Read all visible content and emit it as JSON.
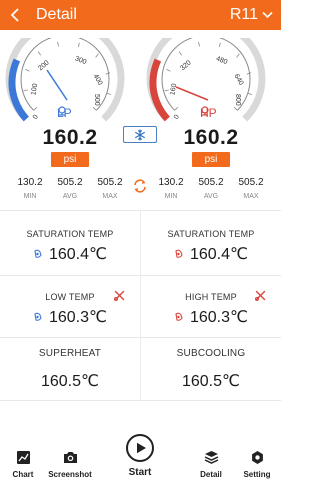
{
  "header": {
    "title": "Detail",
    "refrigerant": "R11"
  },
  "lp": {
    "label": "LP",
    "value": "160.2",
    "unit": "psi",
    "scale": [
      "0",
      "100",
      "200",
      "300",
      "400",
      "500"
    ],
    "min": "130.2",
    "avg": "505.2",
    "max": "505.2",
    "color": "#3c78d8"
  },
  "hp": {
    "label": "HP",
    "value": "160.2",
    "unit": "psi",
    "scale": [
      "0",
      "160",
      "320",
      "480",
      "640",
      "800"
    ],
    "min": "130.2",
    "avg": "505.2",
    "max": "505.2",
    "color": "#d8453c"
  },
  "stat_labels": {
    "min": "MIN",
    "avg": "AVG",
    "max": "MAX"
  },
  "readings": {
    "saturation_left": {
      "title": "SATURATION TEMP",
      "value": "160.4℃"
    },
    "saturation_right": {
      "title": "SATURATION TEMP",
      "value": "160.4℃"
    },
    "low_temp": {
      "title": "LOW TEMP",
      "value": "160.3℃"
    },
    "high_temp": {
      "title": "HIGH TEMP",
      "value": "160.3℃"
    },
    "superheat": {
      "title": "SUPERHEAT",
      "value": "160.5℃"
    },
    "subcooling": {
      "title": "SUBCOOLING",
      "value": "160.5℃"
    }
  },
  "tabs": {
    "chart": "Chart",
    "screenshot": "Screenshot",
    "start": "Start",
    "detail": "Detail",
    "setting": "Setting"
  },
  "colors": {
    "accent": "#f26b1d",
    "lp": "#3c78d8",
    "hp": "#d8453c"
  },
  "icons": [
    "back-arrow-icon",
    "chevron-down-icon",
    "snowflake-icon",
    "refresh-icon",
    "probe-icon",
    "clamp-icon",
    "tool-icon",
    "chart-icon",
    "camera-icon",
    "play-icon",
    "layers-icon",
    "gear-icon"
  ]
}
